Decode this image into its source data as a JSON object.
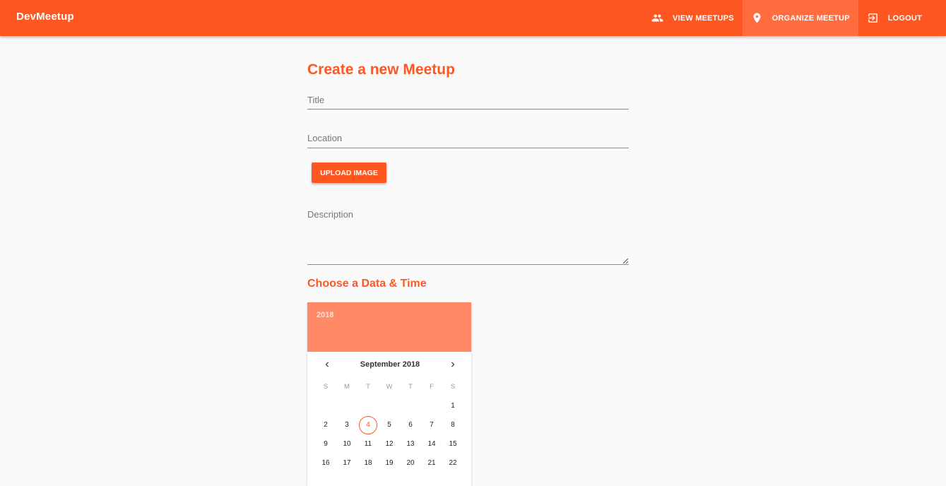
{
  "app": {
    "brand": "DevMeetup",
    "accent": "#ff5722",
    "header_light": "#ff8a65"
  },
  "nav": [
    {
      "label": "VIEW MEETUPS",
      "icon": "group-icon",
      "active": false
    },
    {
      "label": "ORGANIZE MEETUP",
      "icon": "place-icon",
      "active": true
    },
    {
      "label": "LOGOUT",
      "icon": "exit-icon",
      "active": false
    }
  ],
  "form": {
    "title": "Create a new Meetup",
    "title_placeholder": "Title",
    "location_placeholder": "Location",
    "upload_label": "UPLOAD IMAGE",
    "description_placeholder": "Description",
    "datetime_heading": "Choose a Data & Time"
  },
  "datepicker": {
    "year": "2018",
    "month_label": "September 2018",
    "weekdays": [
      "S",
      "M",
      "T",
      "W",
      "T",
      "F",
      "S"
    ],
    "weeks": [
      [
        "",
        "",
        "",
        "",
        "",
        "",
        "1"
      ],
      [
        "2",
        "3",
        "4",
        "5",
        "6",
        "7",
        "8"
      ],
      [
        "9",
        "10",
        "11",
        "12",
        "13",
        "14",
        "15"
      ],
      [
        "16",
        "17",
        "18",
        "19",
        "20",
        "21",
        "22"
      ]
    ],
    "today": "4"
  }
}
